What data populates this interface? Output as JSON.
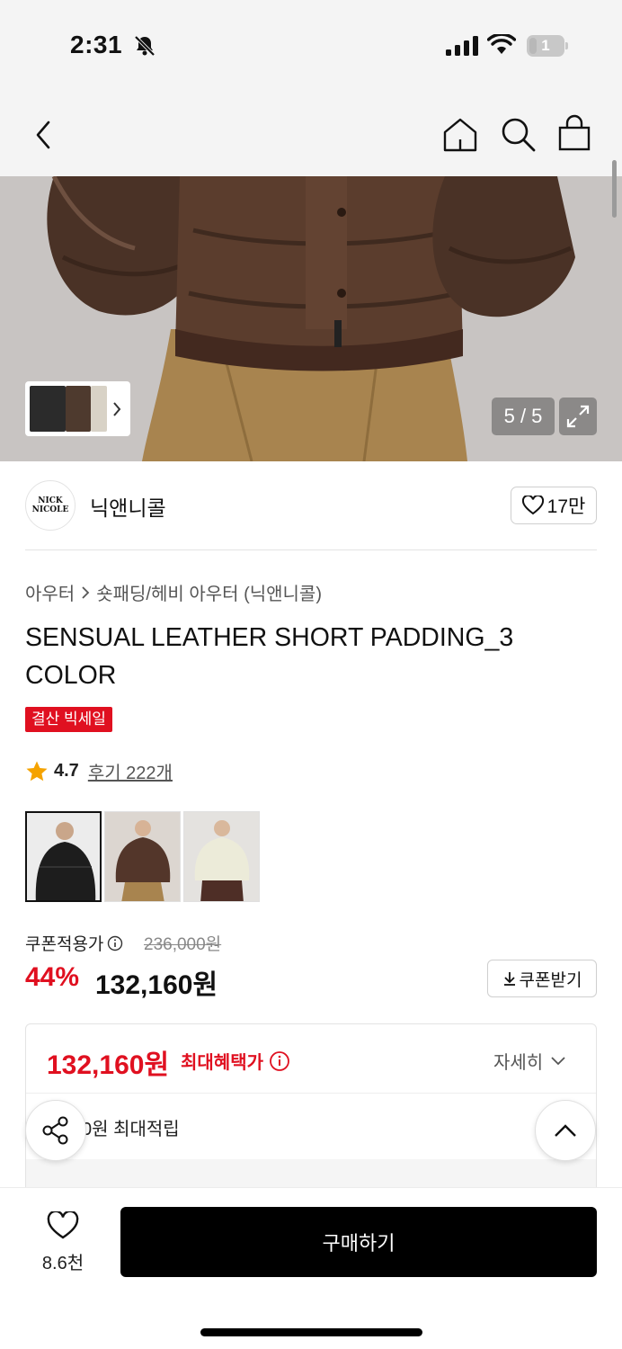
{
  "status_bar": {
    "time": "2:31",
    "battery": "1"
  },
  "gallery": {
    "counter": "5 / 5"
  },
  "brand": {
    "logo_line1": "NICK",
    "logo_line2": "NICOLE",
    "name": "닉앤니콜",
    "likes": "17만"
  },
  "breadcrumb": {
    "category": "아우터",
    "subcategory": "숏패딩/헤비 아우터 (닉앤니콜)"
  },
  "product": {
    "title": "SENSUAL LEATHER SHORT PADDING_3 COLOR",
    "badge": "결산 빅세일",
    "rating": "4.7",
    "reviews": "후기 222개",
    "color_options": [
      "black",
      "brown",
      "cream"
    ]
  },
  "price": {
    "coupon_label": "쿠폰적용가",
    "original": "236,000원",
    "discount": "44%",
    "sale": "132,160원",
    "coupon_button": "쿠폰받기"
  },
  "benefit": {
    "best_price": "132,160원",
    "best_label": "최대혜택가",
    "detail": "자세히",
    "points": "0원 최대적립"
  },
  "bottom_bar": {
    "wish_count": "8.6천",
    "buy": "구매하기"
  },
  "colors": {
    "accent_red": "#e01020",
    "buy_button": "#000000"
  }
}
